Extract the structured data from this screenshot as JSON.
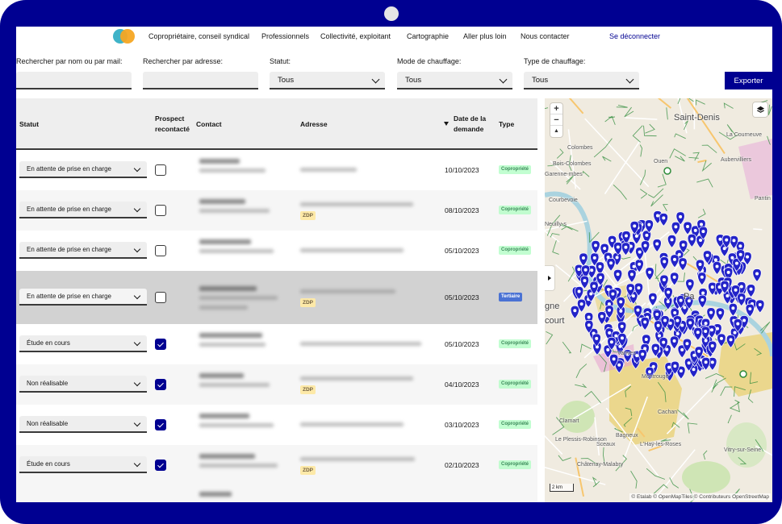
{
  "nav": {
    "links": [
      "Copropriétaire, conseil syndical",
      "Professionnels",
      "Collectivité, exploitant",
      "Cartographie",
      "Aller plus loin",
      "Nous contacter"
    ],
    "logout": "Se déconnecter"
  },
  "filters": {
    "name_label": "Rechercher par nom ou par mail:",
    "address_label": "Rechercher par adresse:",
    "status_label": "Statut:",
    "status_value": "Tous",
    "heating_mode_label": "Mode de chauffage:",
    "heating_mode_value": "Tous",
    "heating_type_label": "Type de chauffage:",
    "heating_type_value": "Tous",
    "export_label": "Exporter"
  },
  "table": {
    "headers": {
      "status": "Statut",
      "prospect_1": "Prospect",
      "prospect_2": "recontacté",
      "contact": "Contact",
      "address": "Adresse",
      "date_1": "Date de la",
      "date_2": "demande",
      "type": "Type"
    },
    "rows": [
      {
        "status": "En attente de prise en charge",
        "checked": false,
        "zdp": "",
        "date": "10/10/2023",
        "type": "Copropriété"
      },
      {
        "status": "En attente de prise en charge",
        "checked": false,
        "zdp": "ZDP",
        "date": "08/10/2023",
        "type": "Copropriété"
      },
      {
        "status": "En attente de prise en charge",
        "checked": false,
        "zdp": "",
        "date": "05/10/2023",
        "type": "Copropriété"
      },
      {
        "status": "En attente de prise en charge",
        "checked": false,
        "zdp": "ZDP",
        "date": "05/10/2023",
        "type": "Tertiaire"
      },
      {
        "status": "Étude en cours",
        "checked": true,
        "zdp": "",
        "date": "05/10/2023",
        "type": "Copropriété"
      },
      {
        "status": "Non réalisable",
        "checked": true,
        "zdp": "ZDP",
        "date": "04/10/2023",
        "type": "Copropriété"
      },
      {
        "status": "Non réalisable",
        "checked": true,
        "zdp": "",
        "date": "03/10/2023",
        "type": "Copropriété"
      },
      {
        "status": "Étude en cours",
        "checked": true,
        "zdp": "ZDP",
        "date": "02/10/2023",
        "type": "Copropriété"
      }
    ]
  },
  "map": {
    "zoom_in": "+",
    "zoom_out": "−",
    "compass": "▲",
    "scale": "2 km",
    "attribution": "© Etalab  © OpenMapTiles  © Contributeurs OpenStreetMap",
    "places": [
      "Saint-Denis",
      "Bois-Colombes",
      "Colombes",
      "Aubervilliers",
      "La Courneuve",
      "Pantin",
      "Neuilly-s",
      "Courbevoie",
      "Garenne-mbes",
      "Montrouge",
      "Clamart",
      "Bagneux",
      "Cachan",
      "Sceaux",
      "Le Plessis-Robinson",
      "L'Haÿ-les-Roses",
      "Châtenay-Malabry",
      "Vitry-sur-Seine",
      "Vanves",
      "gne",
      "court",
      "Pa",
      "Ouen"
    ],
    "marker_color": "#2323c8"
  }
}
